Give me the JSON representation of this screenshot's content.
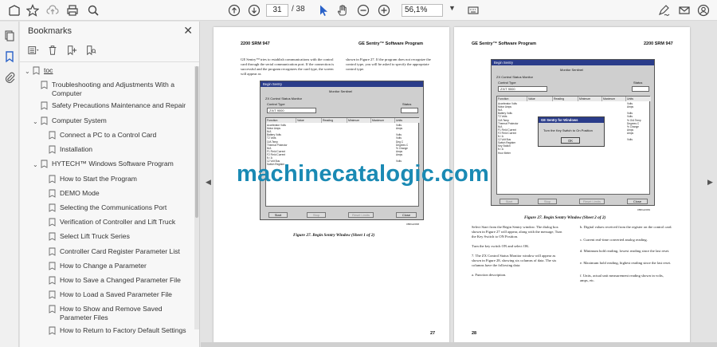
{
  "toolbar": {
    "current_page": "31",
    "total_pages": "/ 38",
    "zoom": "56,1%"
  },
  "bookmarks": {
    "title": "Bookmarks",
    "items": [
      {
        "label": "toc",
        "level": 0,
        "caret": "v",
        "underline": true
      },
      {
        "label": "Troubleshooting and Adjustments With a Computer",
        "level": 1,
        "caret": ""
      },
      {
        "label": "Safety Precautions Maintenance and Repair",
        "level": 1,
        "caret": ""
      },
      {
        "label": "Computer System",
        "level": 1,
        "caret": "v"
      },
      {
        "label": "Connect a PC to a Control Card",
        "level": 2,
        "caret": ""
      },
      {
        "label": "Installation",
        "level": 2,
        "caret": ""
      },
      {
        "label": "HYTECH™ Windows Software Program",
        "level": 1,
        "caret": "v"
      },
      {
        "label": "How to Start the Program",
        "level": 2,
        "caret": ""
      },
      {
        "label": "DEMO Mode",
        "level": 2,
        "caret": ""
      },
      {
        "label": "Selecting the Communications Port",
        "level": 2,
        "caret": ""
      },
      {
        "label": "Verification of Controller and Lift Truck",
        "level": 2,
        "caret": ""
      },
      {
        "label": "Select Lift Truck Series",
        "level": 2,
        "caret": ""
      },
      {
        "label": "Controller Card Register Parameter List",
        "level": 2,
        "caret": ""
      },
      {
        "label": "How to Change a Parameter",
        "level": 2,
        "caret": ""
      },
      {
        "label": "How to Save a Changed Parameter File",
        "level": 2,
        "caret": ""
      },
      {
        "label": "How to Load a Saved Parameter File",
        "level": 2,
        "caret": ""
      },
      {
        "label": "How to Show and Remove Saved Parameter Files",
        "level": 2,
        "caret": ""
      },
      {
        "label": "How to Return to Factory Default Settings",
        "level": 2,
        "caret": ""
      }
    ]
  },
  "left_page": {
    "header_left": "2200 SRM 947",
    "header_right": "GE Sentry™ Software Program",
    "col1": "GE Sentry™ tries to establish communications with the control card through the serial communication port. If the connection is successful and the program recognizes the card type, the screen will appear as",
    "col2": "shown in Figure 27. If the program does not recognize the control type, you will be asked to specify the appropriate control type.",
    "caption": "Figure 27.  Begin Sentry Window (Sheet 1 of 2)",
    "page_number": "27",
    "window_title": "Begin Sentry",
    "monitor_title": "Monitor Sentinel",
    "status_window": "ZX Control Status Monitor",
    "control_type_label": "Control Type",
    "control_type_value": "ZX/T 9000",
    "status_label": "Status",
    "columns": [
      "Function",
      "Value",
      "Reading",
      "Minimum",
      "Maximum",
      "Units"
    ],
    "rows": [
      "Accelerator Volts",
      "Motor Amps",
      "N/A",
      "Battery Volts",
      "T2 Volts",
      "O/A Temp",
      "Thermal Protector",
      "N/A",
      "F1 Field Current",
      "F2 Field Current",
      "N / A",
      "12 Volt Bus",
      "Switch Register"
    ],
    "units": [
      "Volts",
      "Amps",
      "",
      "Volts",
      "Volts",
      "Deg C",
      "Degrees C",
      "% Change",
      "Amps",
      "Amps",
      "",
      "Volts",
      ""
    ],
    "btn_start": "Start",
    "btn_stop": "Stop",
    "btn_reset": "Reset Limits",
    "btn_close": "Close",
    "code": "0880A0068"
  },
  "right_page": {
    "header_left": "GE Sentry™ Software Program",
    "header_right": "2200 SRM 947",
    "caption": "Figure 27.  Begin Sentry Window (Sheet 2 of 2)",
    "page_number": "28",
    "window_title": "Begin Sentry",
    "monitor_title": "Monitor Sentinel",
    "status_window": "ZX Control Status Monitor",
    "control_type_label": "Control Type",
    "control_type_value": "ZX/T 9000",
    "status_label": "Status",
    "columns": [
      "Function",
      "Value",
      "Reading",
      "Minimum",
      "Maximum",
      "Units"
    ],
    "rows": [
      "Accelerator Volts",
      "Motor Amps",
      "N/A",
      "Battery Volts",
      "T2 Volts",
      "O/A Temp",
      "Thermal Protector",
      "N/A",
      "F1 Field Current",
      "F2 Field Current",
      "N / A",
      "12 Volt Bus",
      "Switch Register",
      "Key Switch",
      "N / A",
      "Hour Meter"
    ],
    "units": [
      "Volts",
      "Amps",
      "",
      "Volts",
      "Volts",
      "% O/A Temp",
      "Degrees C",
      "% Change",
      "Amps",
      "Amps",
      "",
      "Volts",
      "",
      "",
      "",
      ""
    ],
    "dialog_title": "GE Sentry for Windows",
    "dialog_msg": "Turn the Key Switch to On Position",
    "dialog_ok": "OK",
    "btn_start": "Start",
    "btn_stop": "Stop",
    "btn_reset": "Reset Limits",
    "btn_close": "Close",
    "code": "0880A0069",
    "left_col": "Select Start from the Begin Sentry window. The dialog box shown in Figure 27 will appear, along with the message, Turn the Key Switch to ON Position.\n\nTurn the key switch ON and select OK.\n\n7.  The ZX Control Status Monitor window will appear as shown in Figure 28, showing six columns of data. The six columns have the following data:\n\n     a.  Function description.",
    "right_col_b": "b.  Digital values received from the register on the control card.",
    "right_col_c": "c.  Current real-time converted analog reading.",
    "right_col_d": "d.  Minimum hold reading, lowest reading since the last reset.",
    "right_col_e": "e.  Maximum hold reading, highest reading since the last reset.",
    "right_col_f": "f.  Units, actual unit measurement reading shown in volts, amps, etc."
  },
  "watermark": "machinecatalogic.com",
  "colors": {
    "watermark": "#1a8ab4",
    "titlebar": "#2a3c8a"
  }
}
